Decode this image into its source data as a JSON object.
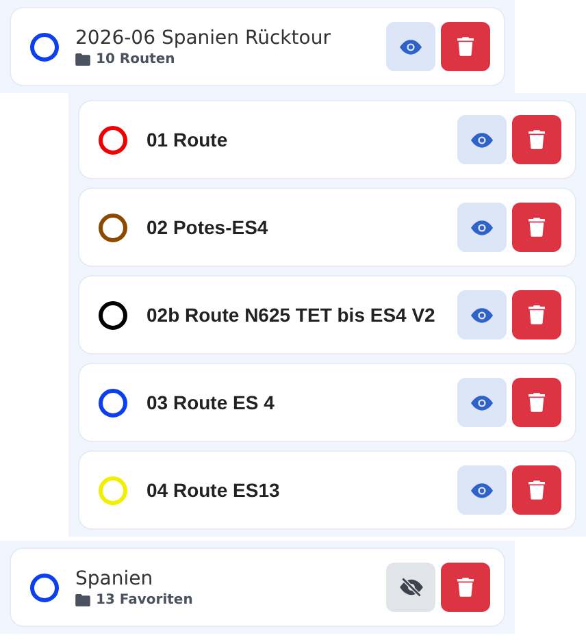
{
  "folders": [
    {
      "title": "2026-06 Spanien Rücktour",
      "count": "10 Routen",
      "color": "#0b3ff0",
      "visible": true,
      "routes": [
        {
          "name": "01 Route",
          "color": "#f00000",
          "visible": true
        },
        {
          "name": "02 Potes-ES4",
          "color": "#8b4a00",
          "visible": true
        },
        {
          "name": "02b Route N625 TET bis ES4 V2",
          "color": "#000000",
          "visible": true
        },
        {
          "name": "03 Route ES 4",
          "color": "#0b3ff0",
          "visible": true
        },
        {
          "name": "04 Route ES13",
          "color": "#f0f000",
          "visible": true
        }
      ]
    },
    {
      "title": "Spanien",
      "count": "13 Favoriten",
      "color": "#0b3ff0",
      "visible": false
    }
  ]
}
